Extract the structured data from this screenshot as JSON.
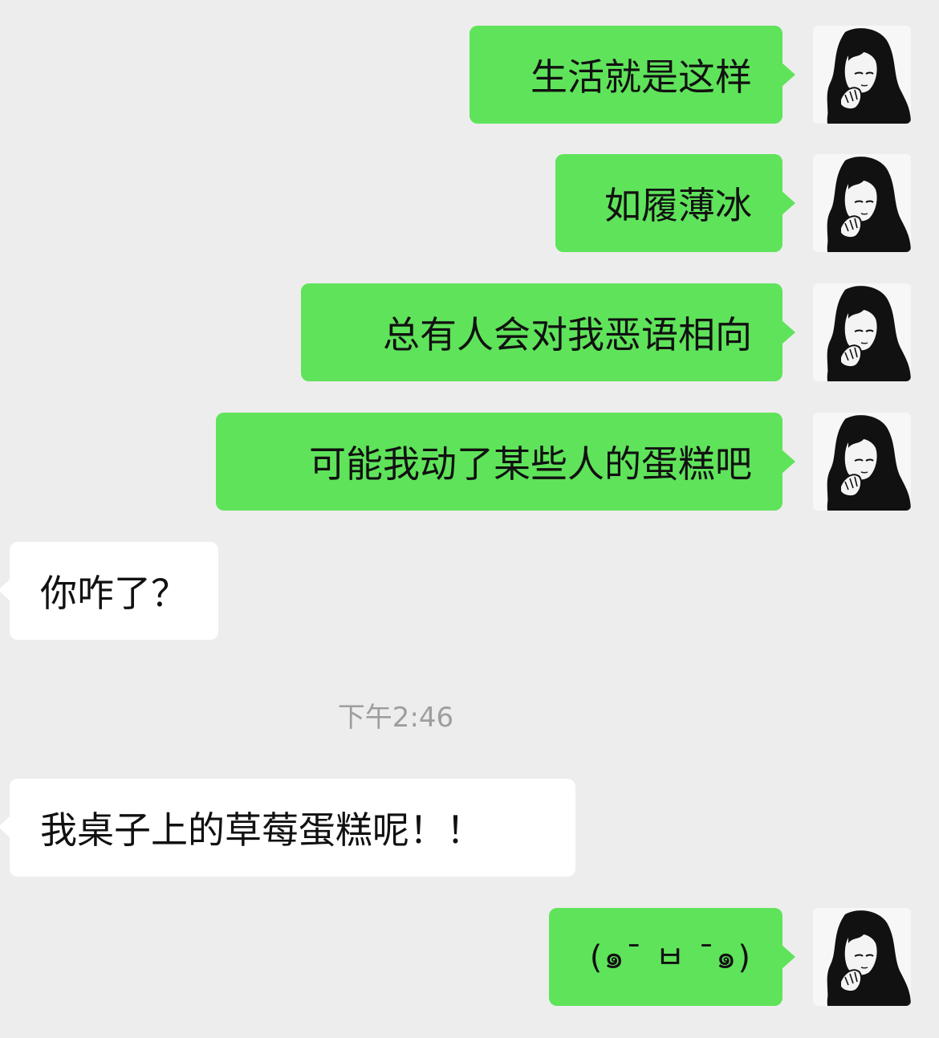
{
  "chat": {
    "messages": [
      {
        "side": "out",
        "text": "生活就是这样"
      },
      {
        "side": "out",
        "text": "如履薄冰"
      },
      {
        "side": "out",
        "text": "总有人会对我恶语相向"
      },
      {
        "side": "out",
        "text": "可能我动了某些人的蛋糕吧"
      },
      {
        "side": "in",
        "text": "你咋了？"
      },
      {
        "side": "in",
        "text": "我桌子上的草莓蛋糕呢！！"
      },
      {
        "side": "out",
        "text": "(๑¯ ㅂ ¯๑)"
      }
    ],
    "timestamp": "下午2:46"
  },
  "colors": {
    "background": "#ededed",
    "outgoing_bubble": "#5fe35a",
    "incoming_bubble": "#ffffff"
  },
  "icons": {
    "avatar": "avatar-icon"
  }
}
